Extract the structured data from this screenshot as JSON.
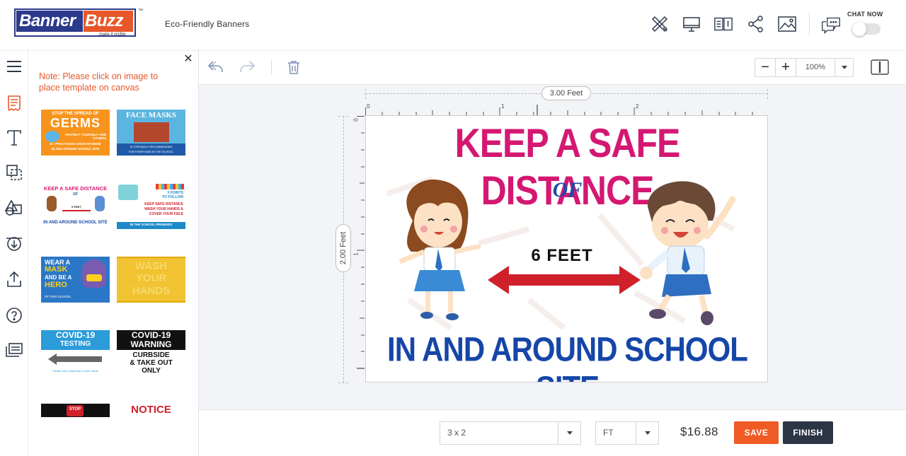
{
  "header": {
    "logo": {
      "word1": "Banner",
      "word2": "Buzz",
      "tagline": "make it visible",
      "tm": "™"
    },
    "product_title": "Eco-Friendly Banners",
    "icons": [
      "design-tools-icon",
      "preview-icon",
      "specs-icon",
      "share-icon",
      "image-icon"
    ],
    "chat": {
      "label": "CHAT NOW",
      "enabled": false
    }
  },
  "rail": {
    "items": [
      "menu-icon",
      "templates-icon",
      "text-icon",
      "shapes-icon",
      "clipart-icon",
      "background-icon",
      "upload-icon",
      "help-icon",
      "layers-icon"
    ]
  },
  "panel": {
    "note": "Note: Please click on image to place template on canvas",
    "templates": [
      {
        "name": "germs",
        "lines": [
          "STOP THE SPREAD OF",
          "GERMS",
          "PROTECT YOURSELF AND OTHERS",
          "BY PRACTICING GOOD HYGIENE",
          "IN AND AROUND SCHOOL SITE"
        ]
      },
      {
        "name": "face-masks",
        "lines": [
          "FACE MASKS",
          "IS STRONGLY RECOMMENDED",
          "FOR EVERYONE IN THE SCHOOL"
        ]
      },
      {
        "name": "safe-distance",
        "lines": [
          "KEEP A SAFE DISTANCE",
          "OF",
          "6 FEET",
          "IN AND AROUND SCHOOL SITE"
        ]
      },
      {
        "name": "three-points",
        "lines": [
          "3 POINTS",
          "TO FOLLOW",
          "KEEP SAFE DISTANCE",
          "WASH YOUR HANDS &",
          "COVER YOUR FACE",
          "IN THE SCHOOL PREMISES"
        ]
      },
      {
        "name": "wear-mask",
        "lines": [
          "WEAR A",
          "MASK",
          "AND BE A",
          "HERO",
          "OF OUR SCHOOL"
        ]
      },
      {
        "name": "wash-hands",
        "lines": [
          "WASH",
          "YOUR",
          "HANDS"
        ]
      },
      {
        "name": "covid-testing",
        "lines": [
          "COVID-19",
          "TESTING",
          "Please have physician's order ready"
        ]
      },
      {
        "name": "covid-warning",
        "lines": [
          "COVID-19",
          "WARNING",
          "CURBSIDE",
          "& TAKE OUT",
          "ONLY"
        ]
      },
      {
        "name": "stop",
        "lines": [
          "STOP"
        ]
      },
      {
        "name": "notice",
        "lines": [
          "NOTICE"
        ]
      }
    ]
  },
  "toolbar": {
    "zoom": "100%",
    "zoom_minus": "−",
    "zoom_plus": "+"
  },
  "canvas": {
    "width_label": "3.00 Feet",
    "height_label": "2.00 Feet",
    "ruler_h": [
      "0",
      "1",
      "2"
    ],
    "ruler_v": [
      "0",
      "1"
    ],
    "sign": {
      "headline": "KEEP A SAFE DISTANCE",
      "of": "OF",
      "feet": "6 FEET",
      "bottom": "IN AND AROUND SCHOOL SITE"
    },
    "colors": {
      "headline": "#d41872",
      "bottom": "#1546a8",
      "arrow": "#d0202a"
    }
  },
  "bottom": {
    "size": "3 x 2",
    "unit": "FT",
    "price": "$16.88",
    "save_label": "SAVE",
    "finish_label": "FINISH",
    "colors": {
      "save": "#f05a24",
      "finish": "#2c3546"
    }
  }
}
